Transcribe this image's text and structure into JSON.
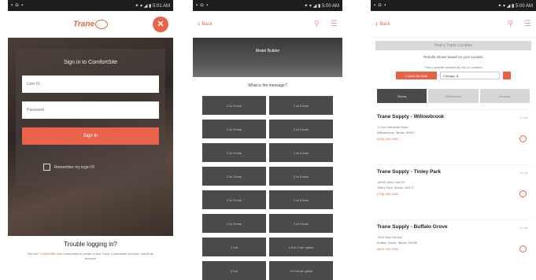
{
  "colors": {
    "accent": "#e8634a",
    "dark_tile": "#4b4b4b",
    "status_bar": "#1d1d1d"
  },
  "screen1": {
    "status_left": "▪ ◘ ▪",
    "status_right": "✦ ▾ ◢ ▮ 5:01 AM",
    "logo_text": "Trane",
    "close_icon": "✕",
    "login_title": "Sign in to ComfortSite",
    "user_placeholder": "User ID",
    "password_placeholder": "Password",
    "signin_label": "Sign In",
    "remember_label": "Remember my login ID",
    "trouble_title": "Trouble logging in?",
    "trouble_text_pre": "We use ",
    "trouble_link": "ComfortSite.com",
    "trouble_text_post": " credentials to create a new Trane Comfortsite account, needs an account."
  },
  "screen2": {
    "status_left": "▪ ◘ ▪",
    "status_right": "✦ ▾ ◢ ▮ 5:00 AM",
    "back_label": "Back",
    "banner_label": "Model Builder",
    "question": "What is the message?",
    "buttons": [
      "2 to 3 tons",
      "2 to 3 tons",
      "2 to 3 tons",
      "2 to 3 tons",
      "2 to 3 tons",
      "2 to 3 tons",
      "2 to 3 tons",
      "2 to 3 tons",
      "2 to 3 tons",
      "2 to 3 tons",
      "2 to 3 tons",
      "2 to 3 tons",
      "2 ton",
      "1.5 to 2 ton option",
      "2 ton",
      "1.5 ton alt option"
    ]
  },
  "screen3": {
    "status_left": "▪ ◘ ▪",
    "status_right": "✦ ▾ ◢ ▮ 5:00 AM",
    "back_label": "Back",
    "find_label": "Find a Trane Location",
    "results_text": "Results shown based on your location",
    "zip_label": "Find a specific location by Zip or Location",
    "locate_label": "Locate Me Now",
    "select_value": "Chicago, IL",
    "tabs": [
      "Stores",
      "Distributors",
      "Dealers"
    ],
    "items": [
      {
        "name": "Trane Supply - Willowbrook",
        "dist": "1.0 mi",
        "addr1": "1 Cool Industrial Road",
        "addr2": "Willowbrook, Illinois, 60527",
        "phone": "(630) 000-0000"
      },
      {
        "name": "Trane Supply - Tinley Park",
        "dist": "1.0 mi",
        "addr1": "16000 West Oak Dr",
        "addr2": "Tinley Park, Illinois, 60477",
        "phone": "(708) 000-0000"
      },
      {
        "name": "Trane Supply - Buffalo Grove",
        "dist": "1.0 mi",
        "addr1": "1234 Nice Rd Ave",
        "addr2": "Buffalo Grove, Illinois, 60089",
        "phone": "(847) 000-0000"
      }
    ]
  }
}
